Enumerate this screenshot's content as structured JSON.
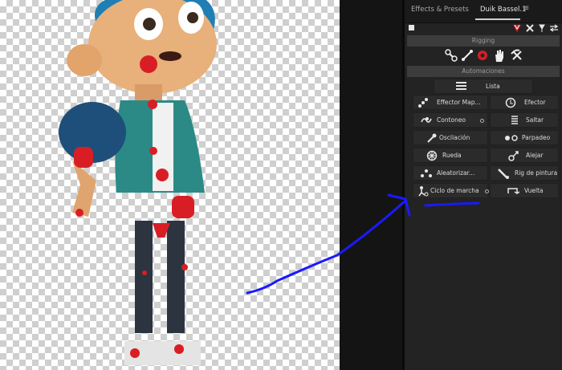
{
  "panel": {
    "tabs": [
      {
        "label": "Effects & Presets"
      },
      {
        "label": "Duik Bassel.1"
      }
    ],
    "tab_menu": "≡",
    "sections": {
      "rigging": "Rigging",
      "automations": "Automaciones"
    },
    "list_button": "Lista",
    "automations": [
      {
        "label": "Effector Map..."
      },
      {
        "label": "Efector"
      },
      {
        "label": "Contoneo"
      },
      {
        "label": "Saltar"
      },
      {
        "label": "Oscilación"
      },
      {
        "label": "Parpadeo"
      },
      {
        "label": "Rueda"
      },
      {
        "label": "Alejar"
      },
      {
        "label": "Aleatorizar..."
      },
      {
        "label": "Rig de pintura"
      },
      {
        "label": "Ciclo de marcha"
      },
      {
        "label": "Vuelta"
      }
    ]
  },
  "colors": {
    "accent_red": "#d81e24",
    "annotation_blue": "#1a1aff",
    "panel_bg": "#232323"
  }
}
